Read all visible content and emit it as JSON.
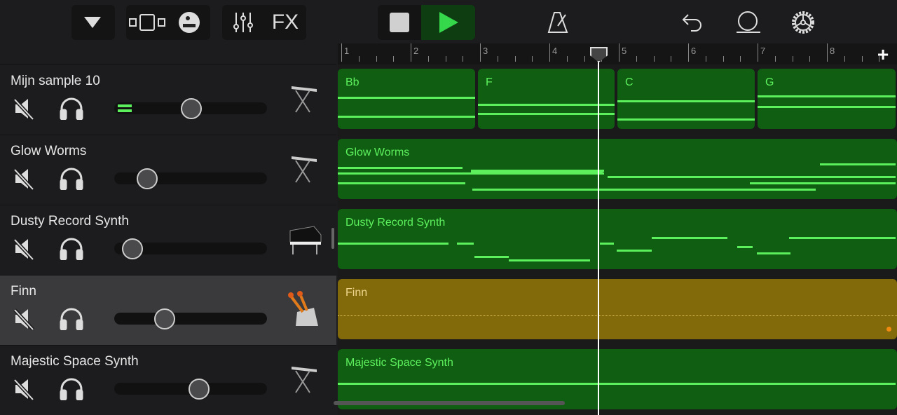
{
  "toolbar": {
    "tracks_menu": "triangle-down-icon",
    "views": "view-switch-icon",
    "smart": "drummer-icon",
    "mixer": "mixer-icon",
    "fx": "FX",
    "stop": "stop-icon",
    "play": "play-icon",
    "metronome": "metronome-icon",
    "undo": "undo-icon",
    "loop": "loop-icon",
    "settings": "gear-icon",
    "add": "+"
  },
  "ruler": {
    "bars": [
      "1",
      "2",
      "3",
      "4",
      "5",
      "6",
      "7",
      "8"
    ]
  },
  "tracks": [
    {
      "name": "Mijn sample 10",
      "volume": 0.5,
      "instrument": "keyboard-icon",
      "meter": true
    },
    {
      "name": "Glow Worms",
      "volume": 0.17,
      "instrument": "keyboard-icon"
    },
    {
      "name": "Dusty Record Synth",
      "volume": 0.06,
      "instrument": "grand-piano-icon"
    },
    {
      "name": "Finn",
      "volume": 0.3,
      "instrument": "percussion-icon",
      "selected": true
    },
    {
      "name": "Majestic Space Synth",
      "volume": 0.56,
      "instrument": "keyboard-icon"
    }
  ],
  "regions": [
    [
      {
        "label": "Bb"
      },
      {
        "label": "F"
      },
      {
        "label": "C"
      },
      {
        "label": "G"
      }
    ],
    [
      {
        "label": "Glow Worms"
      }
    ],
    [
      {
        "label": "Dusty Record Synth"
      }
    ],
    [
      {
        "label": "Finn"
      }
    ],
    [
      {
        "label": "Majestic Space Synth"
      }
    ]
  ],
  "colors": {
    "midi_region": "#0f5e12",
    "note": "#5cf05c",
    "audio_region": "#826a0a",
    "play_accent": "#34c759"
  }
}
